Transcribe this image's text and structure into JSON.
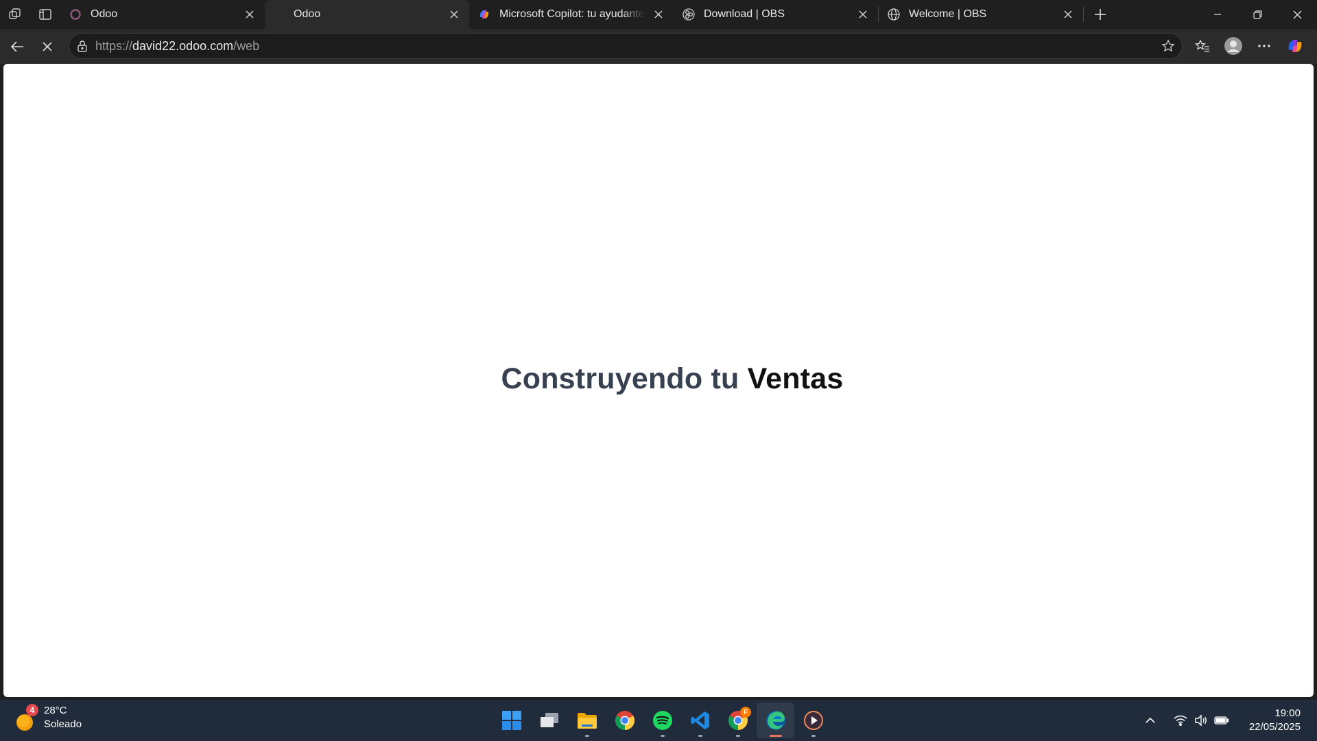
{
  "browser": {
    "tabs": [
      {
        "title": "Odoo",
        "favicon": "odoo-ring-icon",
        "active": false
      },
      {
        "title": "Odoo",
        "favicon": "none",
        "active": true
      },
      {
        "title": "Microsoft Copilot: tu ayudante de",
        "favicon": "copilot-icon",
        "active": false
      },
      {
        "title": "Download | OBS",
        "favicon": "obs-icon",
        "active": false
      },
      {
        "title": "Welcome | OBS",
        "favicon": "globe-icon",
        "active": false
      }
    ],
    "address": {
      "scheme": "https://",
      "host": "david22.odoo.com",
      "path": "/web"
    }
  },
  "page": {
    "heading_prefix": "Construyendo tu",
    "heading_app": "Ventas"
  },
  "taskbar": {
    "weather": {
      "temperature": "28°C",
      "condition": "Soleado",
      "badge": "4"
    },
    "apps": [
      "windows-start-icon",
      "task-view-icon",
      "file-explorer-icon",
      "chrome-icon",
      "spotify-icon",
      "vscode-icon",
      "chrome-profile-icon",
      "edge-icon",
      "media-player-icon"
    ],
    "chrome_profile_badge": "F",
    "clock": {
      "time": "19:00",
      "date": "22/05/2025"
    }
  },
  "colors": {
    "chrome_bg": "#1f1f1f",
    "toolbar_bg": "#2b2b2b",
    "heading_prefix": "#374151",
    "heading_app": "#111111",
    "taskbar_bg": "#202c3c"
  }
}
